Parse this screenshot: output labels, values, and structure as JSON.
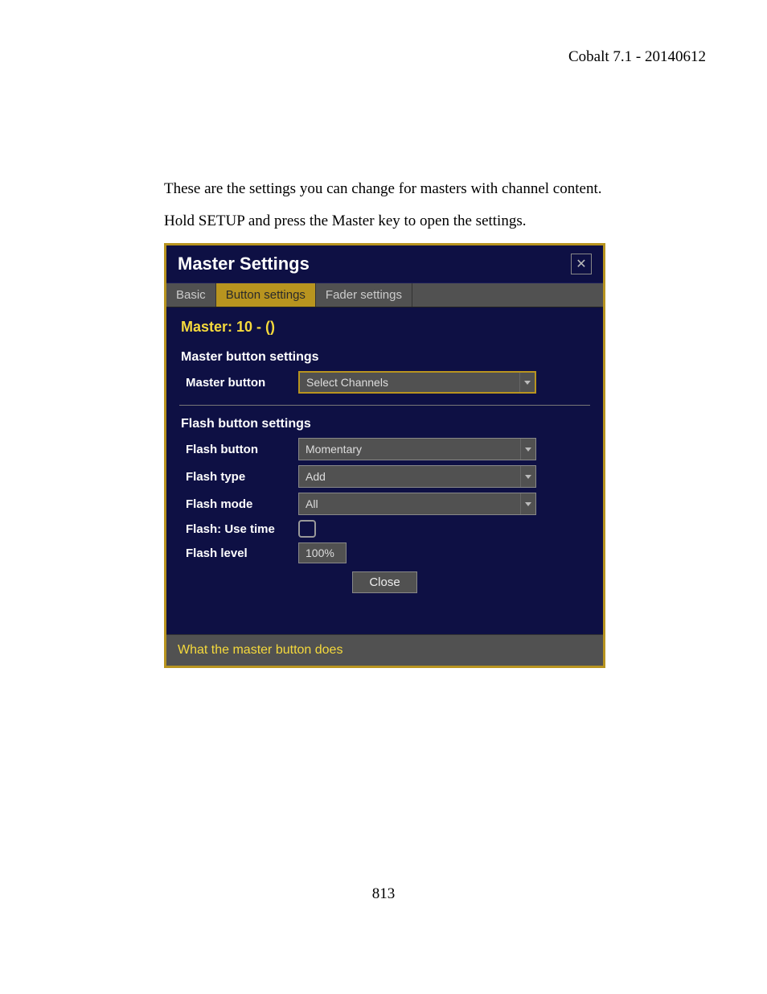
{
  "header": "Cobalt 7.1 - 20140612",
  "intro1": "These are the settings you can change for masters with channel content.",
  "intro2": "Hold SETUP and press the Master key to open the settings.",
  "dialog": {
    "title": "Master Settings",
    "tabs": [
      "Basic",
      "Button settings",
      "Fader settings"
    ],
    "masterLabel": "Master: 10 - ()",
    "section1": "Master button settings",
    "masterButtonLabel": "Master button",
    "masterButtonValue": "Select Channels",
    "section2": "Flash button settings",
    "flashButtonLabel": "Flash button",
    "flashButtonValue": "Momentary",
    "flashTypeLabel": "Flash type",
    "flashTypeValue": "Add",
    "flashModeLabel": "Flash mode",
    "flashModeValue": "All",
    "flashUseTimeLabel": "Flash: Use time",
    "flashLevelLabel": "Flash level",
    "flashLevelValue": "100%",
    "closeBtn": "Close",
    "footer": "What the master button does"
  },
  "pageNumber": "813"
}
